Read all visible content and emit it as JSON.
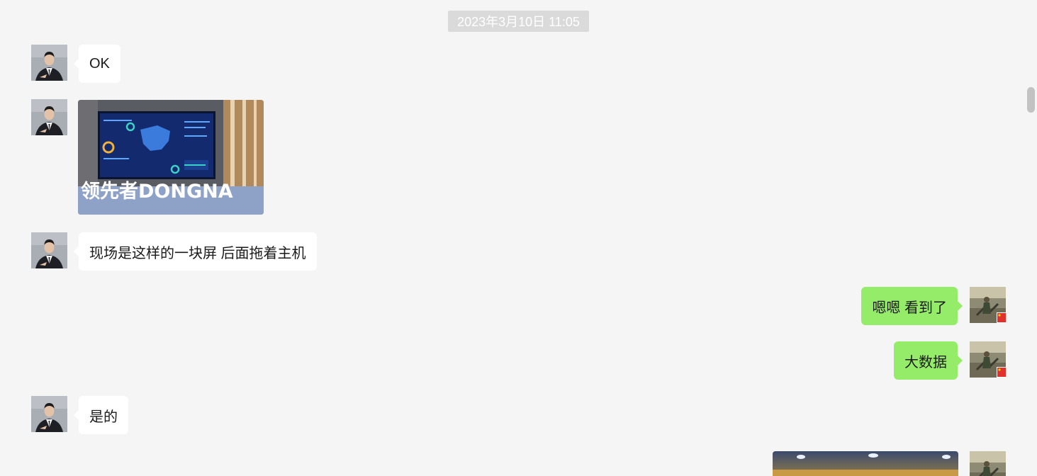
{
  "chat": {
    "timestamp": "2023年3月10日 11:05",
    "messages": [
      {
        "sender": "contact",
        "type": "text",
        "text": "OK"
      },
      {
        "sender": "contact",
        "type": "image",
        "overlay_text": "领先者DONGNA"
      },
      {
        "sender": "contact",
        "type": "text",
        "text": "现场是这样的一块屏 后面拖着主机"
      },
      {
        "sender": "me",
        "type": "text",
        "text": "嗯嗯 看到了"
      },
      {
        "sender": "me",
        "type": "text",
        "text": "大数据"
      },
      {
        "sender": "contact",
        "type": "text",
        "text": "是的"
      },
      {
        "sender": "me",
        "type": "image"
      }
    ]
  },
  "colors": {
    "background": "#f5f5f5",
    "incoming_bubble": "#ffffff",
    "outgoing_bubble": "#95ec69",
    "timestamp_bg": "#dadada"
  },
  "icons": {
    "contact_avatar": "man-in-suit-avatar",
    "my_avatar": "outdoor-photo-avatar-with-flag"
  }
}
